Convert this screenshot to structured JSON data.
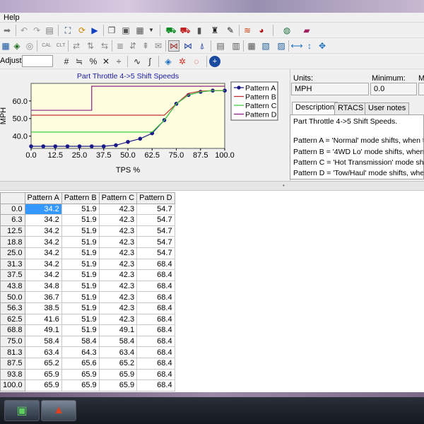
{
  "menu": {
    "help": "Help"
  },
  "adjust": {
    "label": "Adjust:",
    "value": ""
  },
  "chart_data": {
    "type": "line",
    "title": "Part Throttle 4->5 Shift Speeds",
    "xlabel": "TPS %",
    "ylabel": "MPH",
    "x": [
      0.0,
      6.3,
      12.5,
      18.8,
      25.0,
      31.3,
      37.5,
      43.8,
      50.0,
      56.3,
      62.5,
      68.8,
      75.0,
      81.3,
      87.5,
      93.8,
      100.0
    ],
    "xticks": [
      "0.0",
      "12.5",
      "25.0",
      "37.5",
      "50.0",
      "62.5",
      "75.0",
      "87.5",
      "100.0"
    ],
    "yticks": [
      "40.0",
      "50.0",
      "60.0"
    ],
    "ylim": [
      33,
      70
    ],
    "xlim": [
      0,
      100
    ],
    "legend_position": "top-right",
    "series": [
      {
        "name": "Pattern A",
        "color": "#1a1a8a",
        "values": [
          34.2,
          34.2,
          34.2,
          34.2,
          34.2,
          34.2,
          34.2,
          34.8,
          36.7,
          38.5,
          41.6,
          49.1,
          58.4,
          63.4,
          65.2,
          65.9,
          65.9
        ]
      },
      {
        "name": "Pattern B",
        "color": "#c03030",
        "values": [
          51.9,
          51.9,
          51.9,
          51.9,
          51.9,
          51.9,
          51.9,
          51.9,
          51.9,
          51.9,
          51.9,
          51.9,
          58.4,
          64.3,
          65.6,
          65.9,
          65.9
        ]
      },
      {
        "name": "Pattern C",
        "color": "#44cc44",
        "values": [
          42.3,
          42.3,
          42.3,
          42.3,
          42.3,
          42.3,
          42.3,
          42.3,
          42.3,
          42.3,
          42.3,
          49.1,
          58.4,
          63.4,
          65.2,
          65.9,
          65.9
        ]
      },
      {
        "name": "Pattern D",
        "color": "#882288",
        "values": [
          54.7,
          54.7,
          54.7,
          54.7,
          54.7,
          68.4,
          68.4,
          68.4,
          68.4,
          68.4,
          68.4,
          68.4,
          68.4,
          68.4,
          68.4,
          68.4,
          68.4
        ]
      }
    ]
  },
  "info": {
    "units_label": "Units:",
    "minimum_label": "Minimum:",
    "max_label": "M",
    "units_value": "MPH",
    "minimum_value": "0.0",
    "tabs": [
      "Description",
      "RTACS",
      "User notes"
    ],
    "desc_lines": [
      "Part Throttle 4->5 Shift Speeds.",
      "",
      "Pattern A = 'Normal' mode shifts, when th",
      "Pattern B = '4WD Lo' mode shifts, when t",
      "Pattern C = 'Hot Transmission' mode shif",
      "Pattern D = 'Tow/Haul' mode shifts, when"
    ]
  },
  "table": {
    "headers": [
      "Pattern A",
      "Pattern B",
      "Pattern C",
      "Pattern D"
    ],
    "row_labels": [
      "0.0",
      "6.3",
      "12.5",
      "18.8",
      "25.0",
      "31.3",
      "37.5",
      "43.8",
      "50.0",
      "56.3",
      "62.5",
      "68.8",
      "75.0",
      "81.3",
      "87.5",
      "93.8",
      "100.0"
    ],
    "rows": [
      [
        "34.2",
        "51.9",
        "42.3",
        "54.7"
      ],
      [
        "34.2",
        "51.9",
        "42.3",
        "54.7"
      ],
      [
        "34.2",
        "51.9",
        "42.3",
        "54.7"
      ],
      [
        "34.2",
        "51.9",
        "42.3",
        "54.7"
      ],
      [
        "34.2",
        "51.9",
        "42.3",
        "54.7"
      ],
      [
        "34.2",
        "51.9",
        "42.3",
        "68.4"
      ],
      [
        "34.2",
        "51.9",
        "42.3",
        "68.4"
      ],
      [
        "34.8",
        "51.9",
        "42.3",
        "68.4"
      ],
      [
        "36.7",
        "51.9",
        "42.3",
        "68.4"
      ],
      [
        "38.5",
        "51.9",
        "42.3",
        "68.4"
      ],
      [
        "41.6",
        "51.9",
        "42.3",
        "68.4"
      ],
      [
        "49.1",
        "51.9",
        "49.1",
        "68.4"
      ],
      [
        "58.4",
        "58.4",
        "58.4",
        "68.4"
      ],
      [
        "63.4",
        "64.3",
        "63.4",
        "68.4"
      ],
      [
        "65.2",
        "65.6",
        "65.2",
        "68.4"
      ],
      [
        "65.9",
        "65.9",
        "65.9",
        "68.4"
      ],
      [
        "65.9",
        "65.9",
        "65.9",
        "68.4"
      ]
    ]
  },
  "toolbar": {
    "row1": [
      "forward-icon",
      "undo-icon",
      "redo-icon",
      "clipboard-icon",
      "select-icon",
      "refresh-icon",
      "play-icon",
      "copy-icon",
      "paste-icon",
      "paste-special-icon",
      "dropdown-icon",
      "car-green-icon",
      "car-red-icon",
      "traffic-light-icon",
      "chess-icon",
      "wand-icon",
      "tuning-icon",
      "gauge-icon",
      "globe-icon",
      "book-icon"
    ],
    "row2": [
      "grid-icon",
      "cube-icon",
      "disc-icon",
      "cal-icon",
      "clt-icon",
      "swap-icon",
      "columns-icon",
      "arrows-icon",
      "rows-icon",
      "compare-icon",
      "up-icon",
      "envelope-icon",
      "flag-icon",
      "graph-select-icon",
      "graph-icon",
      "pyramid-icon",
      "table-icon",
      "bar-icon",
      "table2-icon",
      "stack-icon",
      "move-icon",
      "h-arrow-icon",
      "v-arrow-icon",
      "cross-arrow-icon"
    ],
    "row3": [
      "hash-icon",
      "approx-icon",
      "percent-icon",
      "multiply-icon",
      "divide-icon",
      "wave-icon",
      "smooth-icon",
      "diamond-icon",
      "rotate-icon",
      "target-icon",
      "plus-circle-icon"
    ]
  }
}
